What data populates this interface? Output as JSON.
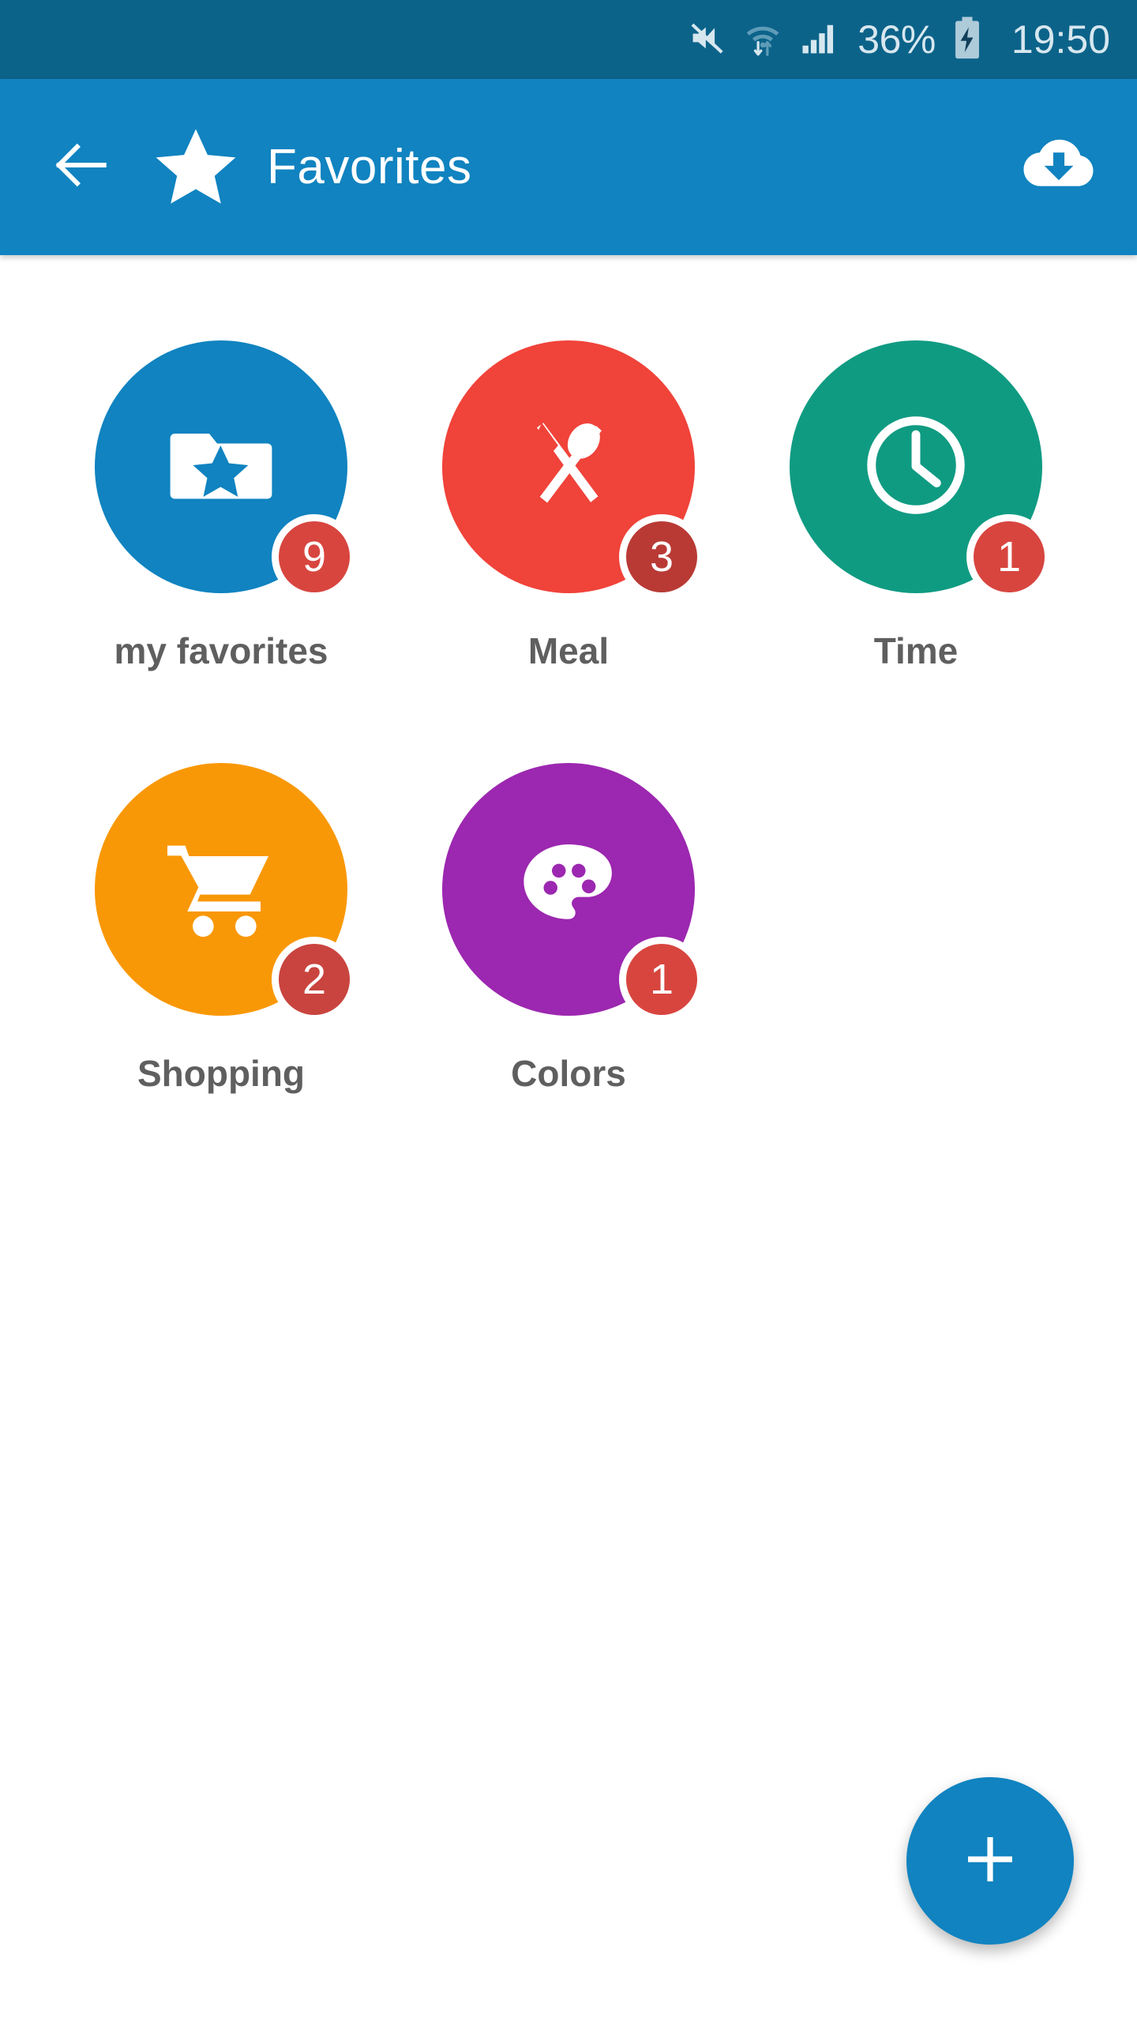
{
  "status_bar": {
    "background": "#0c6389",
    "text_color": "#d7e7ef",
    "battery_percent": "36%",
    "clock": "19:50",
    "icons": [
      "mute-icon",
      "wifi-transfer-icon",
      "cellular-signal-icon",
      "battery-charging-icon"
    ]
  },
  "app_bar": {
    "background": "#1083c0",
    "title": "Favorites",
    "back_icon": "arrow-left-icon",
    "leading_icon": "star-icon",
    "action_icon": "cloud-download-icon"
  },
  "categories": [
    {
      "label": "my favorites",
      "badge": "9",
      "color": "#1083c0",
      "icon": "folder-star-icon"
    },
    {
      "label": "Meal",
      "badge": "3",
      "color": "#f0433a",
      "icon": "cutlery-icon"
    },
    {
      "label": "Time",
      "badge": "1",
      "color": "#0f9b82",
      "icon": "clock-icon"
    },
    {
      "label": "Shopping",
      "badge": "2",
      "color": "#f99806",
      "icon": "shopping-cart-icon"
    },
    {
      "label": "Colors",
      "badge": "1",
      "color": "#9c27b0",
      "icon": "palette-icon"
    }
  ],
  "badge_color": "#d8453f",
  "label_color": "#5f5f5f",
  "fab": {
    "icon": "plus-icon",
    "color": "#1083c0"
  }
}
